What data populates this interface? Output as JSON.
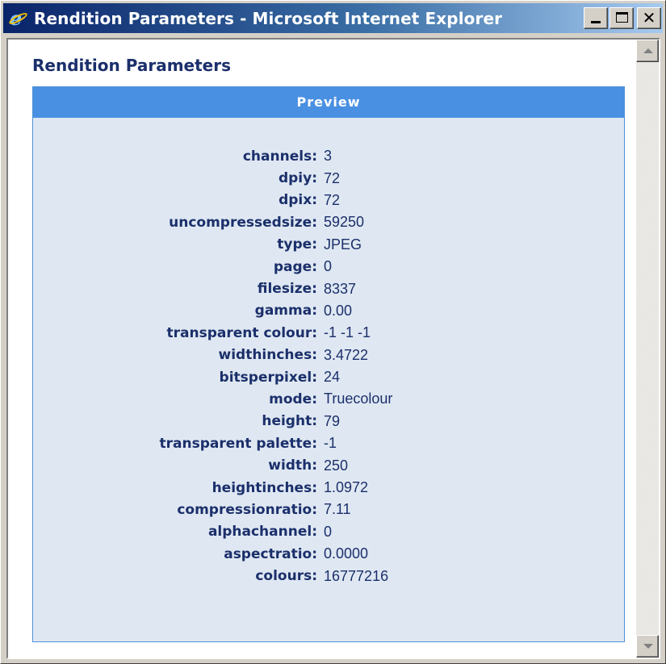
{
  "window": {
    "title": "Rendition Parameters - Microsoft Internet Explorer"
  },
  "window_buttons": {
    "minimize": "_",
    "maximize": "□",
    "close": "✕"
  },
  "page": {
    "heading": "Rendition Parameters",
    "panel_title": "Preview",
    "params": [
      {
        "label": "channels:",
        "value": "3"
      },
      {
        "label": "dpiy:",
        "value": "72"
      },
      {
        "label": "dpix:",
        "value": "72"
      },
      {
        "label": "uncompressedsize:",
        "value": "59250"
      },
      {
        "label": "type:",
        "value": "JPEG"
      },
      {
        "label": "page:",
        "value": "0"
      },
      {
        "label": "filesize:",
        "value": "8337"
      },
      {
        "label": "gamma:",
        "value": "0.00"
      },
      {
        "label": "transparent colour:",
        "value": "-1 -1 -1"
      },
      {
        "label": "widthinches:",
        "value": "3.4722"
      },
      {
        "label": "bitsperpixel:",
        "value": "24"
      },
      {
        "label": "mode:",
        "value": "Truecolour"
      },
      {
        "label": "height:",
        "value": "79"
      },
      {
        "label": "transparent palette:",
        "value": "-1"
      },
      {
        "label": "width:",
        "value": "250"
      },
      {
        "label": "heightinches:",
        "value": "1.0972"
      },
      {
        "label": "compressionratio:",
        "value": "7.11"
      },
      {
        "label": "alphachannel:",
        "value": "0"
      },
      {
        "label": "aspectratio:",
        "value": "0.0000"
      },
      {
        "label": "colours:",
        "value": "16777216"
      }
    ]
  },
  "icons": {
    "app": "ie-icon",
    "scroll_up": "arrow-up-icon",
    "scroll_down": "arrow-down-icon"
  },
  "colors": {
    "titlebar_start": "#0a246a",
    "panel_header": "#4a90e2",
    "panel_bg": "#dfe8f2",
    "text": "#1b2f6b"
  }
}
